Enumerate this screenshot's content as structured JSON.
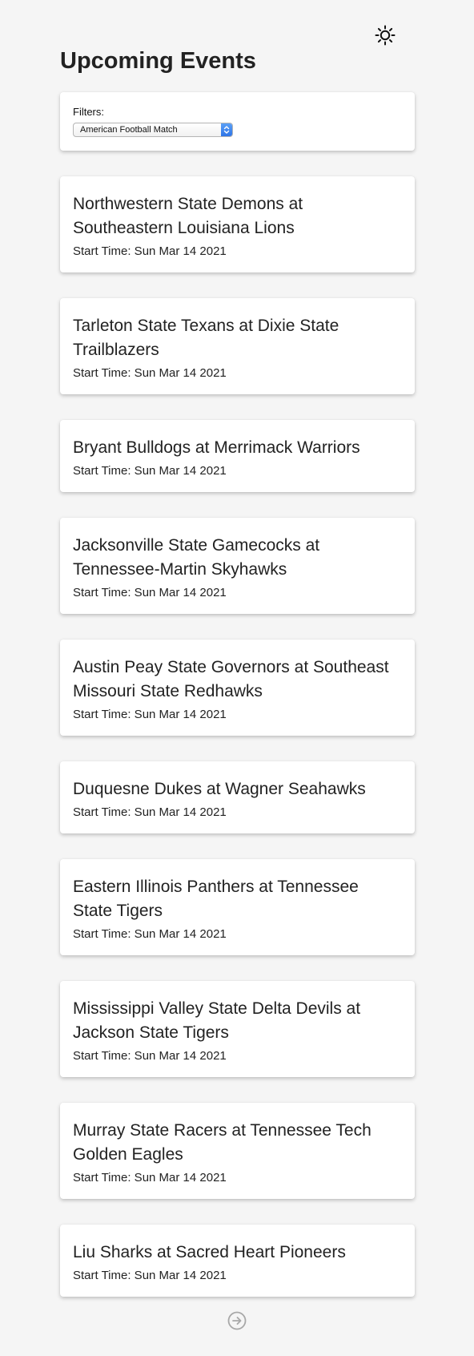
{
  "header": {
    "title": "Upcoming Events",
    "theme_icon": "sun-icon"
  },
  "filters": {
    "label": "Filters:",
    "selected": "American Football Match"
  },
  "events": [
    {
      "title": "Northwestern State Demons at Southeastern Louisiana Lions",
      "time": "Start Time: Sun Mar 14 2021"
    },
    {
      "title": "Tarleton State Texans at Dixie State Trailblazers",
      "time": "Start Time: Sun Mar 14 2021"
    },
    {
      "title": "Bryant Bulldogs at Merrimack Warriors",
      "time": "Start Time: Sun Mar 14 2021"
    },
    {
      "title": "Jacksonville State Gamecocks at Tennessee-Martin Skyhawks",
      "time": "Start Time: Sun Mar 14 2021"
    },
    {
      "title": "Austin Peay State Governors at Southeast Missouri State Redhawks",
      "time": "Start Time: Sun Mar 14 2021"
    },
    {
      "title": "Duquesne Dukes at Wagner Seahawks",
      "time": "Start Time: Sun Mar 14 2021"
    },
    {
      "title": "Eastern Illinois Panthers at Tennessee State Tigers",
      "time": "Start Time: Sun Mar 14 2021"
    },
    {
      "title": "Mississippi Valley State Delta Devils at Jackson State Tigers",
      "time": "Start Time: Sun Mar 14 2021"
    },
    {
      "title": "Murray State Racers at Tennessee Tech Golden Eagles",
      "time": "Start Time: Sun Mar 14 2021"
    },
    {
      "title": "Liu Sharks at Sacred Heart Pioneers",
      "time": "Start Time: Sun Mar 14 2021"
    }
  ],
  "pagination": {
    "next_icon": "arrow-right-circle-icon"
  },
  "colors": {
    "background": "#f5f5f5",
    "card": "#ffffff",
    "text": "#222222",
    "select_accent": "#2f74e6"
  }
}
